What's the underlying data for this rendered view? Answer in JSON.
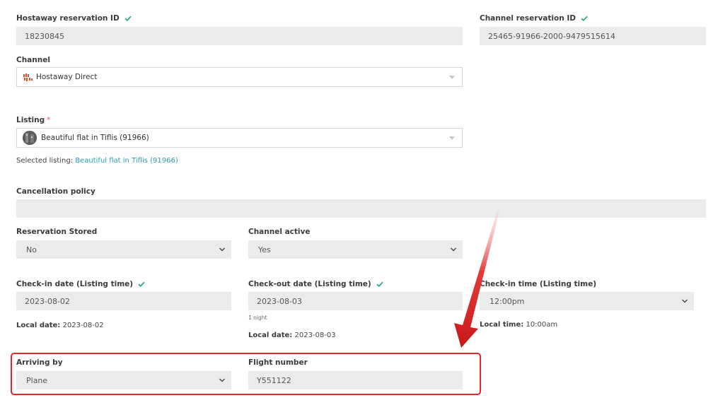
{
  "hostaway_id": {
    "label": "Hostaway reservation ID",
    "value": "18230845"
  },
  "channel_reservation_id": {
    "label": "Channel reservation ID",
    "value": "25465-91966-2000-9479515614"
  },
  "channel": {
    "label": "Channel",
    "value": "Hostaway Direct",
    "icon": "hostaway-logo-icon"
  },
  "listing": {
    "label": "Listing",
    "required_mark": "*",
    "value": "Beautiful flat in Tiflis (91966)",
    "selected_prefix": "Selected listing:",
    "selected_link": "Beautiful flat in Tiflis  (91966)"
  },
  "cancellation_policy": {
    "label": "Cancellation policy",
    "value": ""
  },
  "reservation_stored": {
    "label": "Reservation Stored",
    "value": "No"
  },
  "channel_active": {
    "label": "Channel active",
    "value": "Yes"
  },
  "checkin": {
    "label": "Check-in date (Listing time)",
    "value": "2023-08-02",
    "local_label": "Local date:",
    "local_value": "2023-08-02"
  },
  "checkout": {
    "label": "Check-out date (Listing time)",
    "value": "2023-08-03",
    "nights": "1 night",
    "local_label": "Local date:",
    "local_value": "2023-08-03"
  },
  "checkin_time": {
    "label": "Check-in time (Listing time)",
    "value": "12:00pm",
    "local_label": "Local time:",
    "local_value": "10:00am"
  },
  "arriving_by": {
    "label": "Arriving by",
    "value": "Plane"
  },
  "flight_number": {
    "label": "Flight number",
    "value": "Y551122"
  },
  "colors": {
    "accent_check": "#2eaa7a",
    "link": "#2a9db0",
    "highlight": "#e0282b"
  }
}
